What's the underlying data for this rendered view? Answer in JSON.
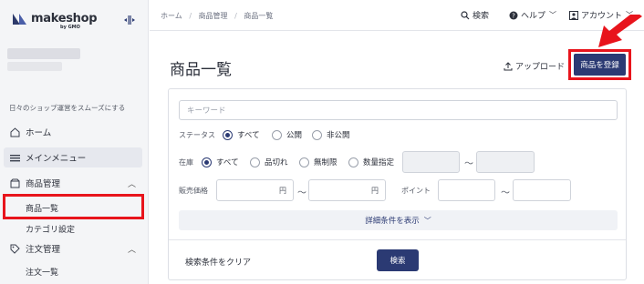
{
  "sidebar": {
    "logo": "makeshop",
    "logo_sub": "by GMO",
    "tagline": "日々のショップ運営をスムーズにする",
    "items": [
      {
        "label": "ホーム",
        "icon": "home-icon"
      },
      {
        "label": "メインメニュー",
        "icon": "menu-icon"
      },
      {
        "label": "商品管理",
        "icon": "box-icon"
      },
      {
        "label": "注文管理",
        "icon": "tag-icon"
      }
    ],
    "sub_products": [
      "商品一覧",
      "カテゴリ設定"
    ],
    "sub_orders": [
      "注文一覧"
    ]
  },
  "topbar": {
    "breadcrumb": [
      "ホーム",
      "商品管理",
      "商品一覧"
    ],
    "search": "検索",
    "help": "ヘルプ",
    "account": "アカウント"
  },
  "main": {
    "title": "商品一覧",
    "upload": "アップロード",
    "register": "商品を登録"
  },
  "search": {
    "keyword_placeholder": "キーワード",
    "status_label": "ステータス",
    "status_options": [
      "すべて",
      "公開",
      "非公開"
    ],
    "stock_label": "在庫",
    "stock_options": [
      "すべて",
      "品切れ",
      "無制限",
      "数量指定"
    ],
    "price_label": "販売価格",
    "point_label": "ポイント",
    "yen": "円",
    "tilde": "〜",
    "advanced": "詳細条件を表示",
    "clear": "検索条件をクリア",
    "submit": "検索"
  },
  "colors": {
    "accent": "#2b3a73",
    "highlight": "#e8141c"
  }
}
